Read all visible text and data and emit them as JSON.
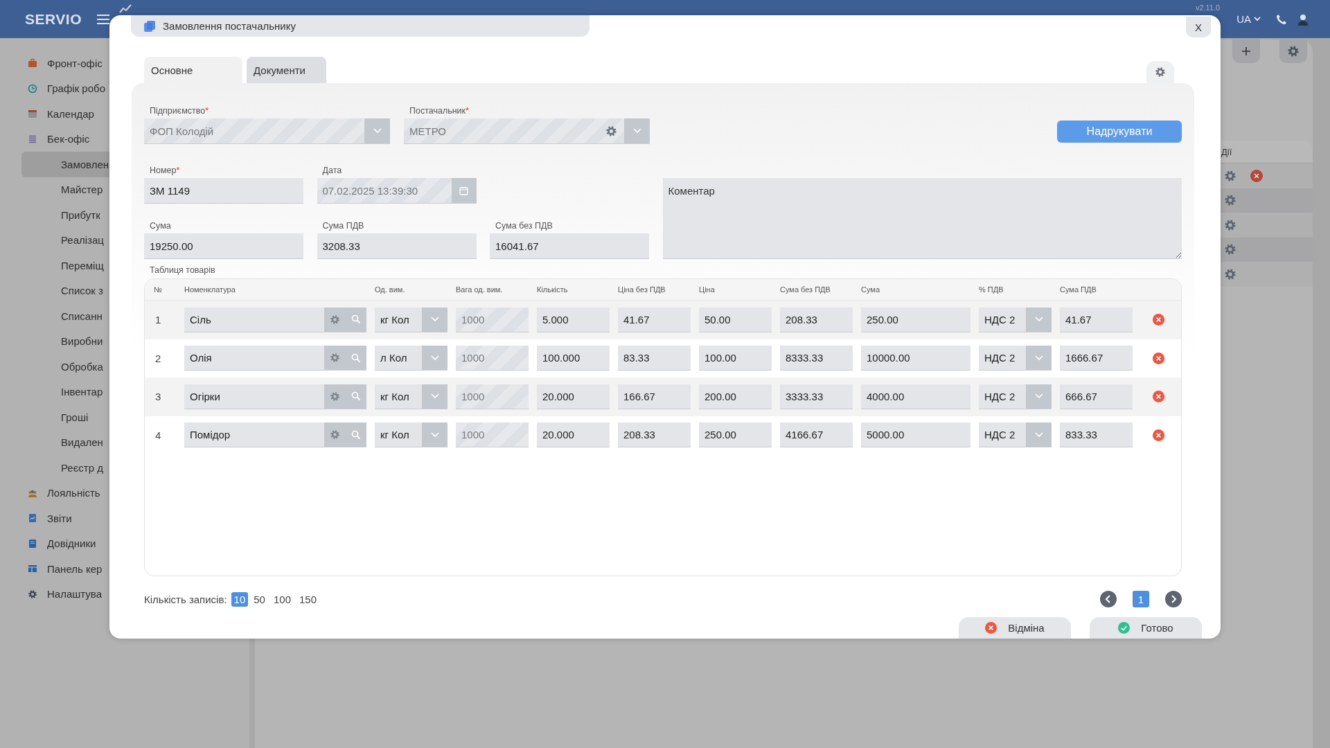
{
  "top_bar": {
    "logo": "SERVIO",
    "version": "v2.11.0",
    "language": "UA"
  },
  "sidebar": {
    "items": [
      {
        "label": "Фронт-офіс",
        "selected": false
      },
      {
        "label": "Графік робо",
        "selected": false
      },
      {
        "label": "Календар",
        "selected": false
      },
      {
        "label": "Бек-офіс",
        "selected": false,
        "children": [
          {
            "label": "Замовлен",
            "selected": true
          },
          {
            "label": "Майстер",
            "selected": false
          },
          {
            "label": "Прибутк",
            "selected": false
          },
          {
            "label": "Реалізац",
            "selected": false
          },
          {
            "label": "Переміщ",
            "selected": false
          },
          {
            "label": "Список з",
            "selected": false
          },
          {
            "label": "Списанн",
            "selected": false
          },
          {
            "label": "Виробни",
            "selected": false
          },
          {
            "label": "Обробка",
            "selected": false
          },
          {
            "label": "Інвентар",
            "selected": false
          },
          {
            "label": "Гроші",
            "selected": false
          },
          {
            "label": "Видален",
            "selected": false
          },
          {
            "label": "Реєстр д",
            "selected": false
          }
        ]
      },
      {
        "label": "Лояльність",
        "selected": false
      },
      {
        "label": "Звіти",
        "selected": false
      },
      {
        "label": "Довідники",
        "selected": false
      },
      {
        "label": "Панель кер",
        "selected": false
      },
      {
        "label": "Налаштува",
        "selected": false
      }
    ]
  },
  "background_table": {
    "column_header": "Дії",
    "rows": [
      {
        "removable": true
      },
      {
        "removable": false
      },
      {
        "removable": false
      },
      {
        "removable": false
      },
      {
        "removable": false
      }
    ]
  },
  "dialog": {
    "title": "Замовлення постачальнику",
    "close": "X",
    "tabs": [
      {
        "label": "Основне",
        "selected": true
      },
      {
        "label": "Документи",
        "selected": false
      }
    ],
    "enterprise": {
      "label": "Підприємство",
      "mark": "*",
      "value": "ФОП Колодій",
      "disabled": true
    },
    "supplier": {
      "label": "Постачальник",
      "mark": "*",
      "value": "МЕТРО",
      "disabled": true
    },
    "print_button": "Надрукувати",
    "number": {
      "label": "Номер",
      "mark": "*",
      "value": "ЗМ 1149",
      "disabled": false
    },
    "date": {
      "label": "Дата",
      "value": "07.02.2025 13:39:30",
      "disabled": true
    },
    "comment": {
      "placeholder": "Коментар"
    },
    "sum": {
      "label": "Сума",
      "value": "19250.00",
      "disabled": false
    },
    "vat_sum": {
      "label": "Сума ПДВ",
      "value": "3208.33",
      "disabled": false
    },
    "sum_without_vat": {
      "label": "Сума без ПДВ",
      "value": "16041.67",
      "disabled": false
    },
    "table_label": "Таблиця товарів",
    "table": {
      "columns": [
        "№",
        "Номенклатура",
        "Од. вим.",
        "Вага од. вим.",
        "Кількість",
        "Ціна без ПДВ",
        "Ціна",
        "Сума без ПДВ",
        "Сума",
        "% ПДВ",
        "Сума ПДВ"
      ],
      "rows": [
        {
          "number": "1",
          "item": "Сіль",
          "unit": "кг Кол",
          "weight": "1000",
          "quantity": "5.000",
          "price_without_vat": "41.67",
          "price": "50.00",
          "sum_without_vat": "208.33",
          "sum": "250.00",
          "vat_rate": "НДС 2",
          "vat_sum": "41.67"
        },
        {
          "number": "2",
          "item": "Олія",
          "unit": "л Кол",
          "weight": "1000",
          "quantity": "100.000",
          "price_without_vat": "83.33",
          "price": "100.00",
          "sum_without_vat": "8333.33",
          "sum": "10000.00",
          "vat_rate": "НДС 2",
          "vat_sum": "1666.67"
        },
        {
          "number": "3",
          "item": "Огірки",
          "unit": "кг Кол",
          "weight": "1000",
          "quantity": "20.000",
          "price_without_vat": "166.67",
          "price": "200.00",
          "sum_without_vat": "3333.33",
          "sum": "4000.00",
          "vat_rate": "НДС 2",
          "vat_sum": "666.67"
        },
        {
          "number": "4",
          "item": "Помідор",
          "unit": "кг Кол",
          "weight": "1000",
          "quantity": "20.000",
          "price_without_vat": "208.33",
          "price": "250.00",
          "sum_without_vat": "4166.67",
          "sum": "5000.00",
          "vat_rate": "НДС 2",
          "vat_sum": "833.33"
        }
      ]
    },
    "records_label": "Кількість записів:",
    "page_sizes": [
      {
        "label": "10",
        "selected": true
      },
      {
        "label": "50",
        "selected": false
      },
      {
        "label": "100",
        "selected": false
      },
      {
        "label": "150",
        "selected": false
      }
    ],
    "pages": [
      {
        "label": "1",
        "selected": true
      }
    ],
    "cancel_button": "Відміна",
    "done_button": "Готово"
  }
}
